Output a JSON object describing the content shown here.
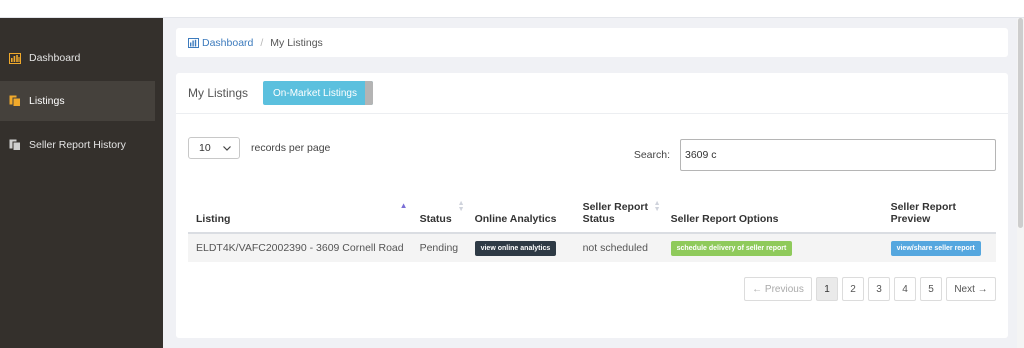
{
  "sidebar": {
    "items": [
      {
        "label": "Dashboard",
        "icon": "bar-chart-icon"
      },
      {
        "label": "Listings",
        "icon": "copy-icon",
        "active": true
      },
      {
        "label": "Seller Report History",
        "icon": "copy-icon"
      }
    ]
  },
  "breadcrumb": {
    "dashboard": "Dashboard",
    "separator": "/",
    "current": "My Listings"
  },
  "card": {
    "title": "My Listings",
    "tab": "On-Market Listings"
  },
  "length_menu": {
    "value": "10",
    "suffix": "records per page"
  },
  "search": {
    "label": "Search:",
    "value": "3609 c"
  },
  "table": {
    "headers": {
      "listing": "Listing",
      "status": "Status",
      "analytics": "Online Analytics",
      "report_status_1": "Seller Report",
      "report_status_2": "Status",
      "options": "Seller Report Options",
      "preview": "Seller Report Preview"
    },
    "rows": [
      {
        "listing": "ELDT4K/VAFC2002390 - 3609 Cornell Road",
        "status": "Pending",
        "analytics": "view online analytics",
        "report_status": "not scheduled",
        "options": "schedule delivery of seller report",
        "preview": "view/share seller report"
      }
    ]
  },
  "pagination": {
    "prev": "← Previous",
    "pages": [
      "1",
      "2",
      "3",
      "4",
      "5"
    ],
    "active_page": "1",
    "next": "Next →"
  },
  "colors": {
    "sidebar_bg": "#34302c",
    "accent_tab": "#5bc0de",
    "link": "#3d7bbd",
    "analytics_btn": "#2e3a45",
    "schedule_btn": "#8fca5b",
    "preview_btn": "#55a7df"
  }
}
